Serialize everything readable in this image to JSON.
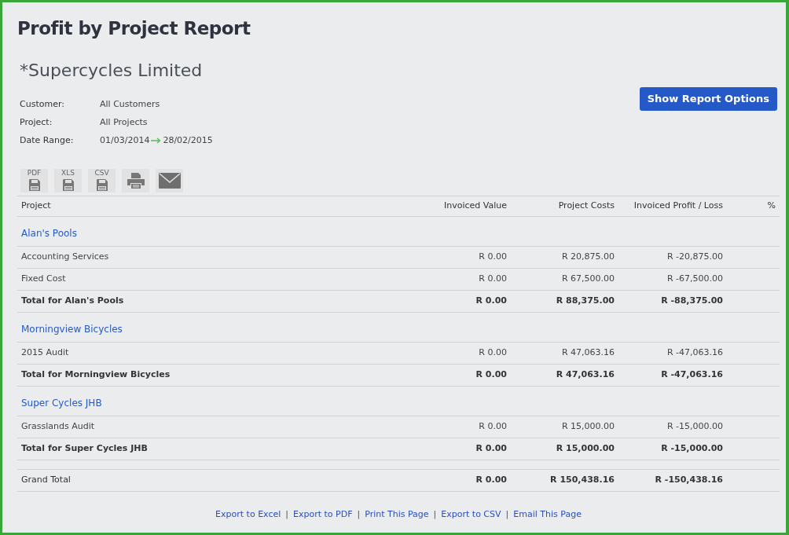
{
  "title": "Profit by Project Report",
  "company": "*Supercycles Limited",
  "filters": [
    {
      "label": "Customer:",
      "value": "All Customers"
    },
    {
      "label": "Project:",
      "value": "All Projects"
    },
    {
      "label": "Date Range:",
      "from": "01/03/2014",
      "to": "28/02/2015"
    }
  ],
  "options_button": "Show Report Options",
  "toolbar": [
    {
      "kind": "save",
      "label": "PDF"
    },
    {
      "kind": "save",
      "label": "XLS"
    },
    {
      "kind": "save",
      "label": "CSV"
    },
    {
      "kind": "print"
    },
    {
      "kind": "email"
    }
  ],
  "table": {
    "columns": [
      "Project",
      "Invoiced Value",
      "Project Costs",
      "Invoiced Profit / Loss",
      "%"
    ],
    "rows": [
      {
        "kind": "group",
        "name": "Alan's Pools"
      },
      {
        "kind": "item",
        "cells": [
          "Accounting Services",
          "R 0.00",
          "R 20,875.00",
          "R -20,875.00"
        ]
      },
      {
        "kind": "item",
        "cells": [
          "Fixed Cost",
          "R 0.00",
          "R 67,500.00",
          "R -67,500.00"
        ]
      },
      {
        "kind": "total",
        "cells": [
          "Total for Alan's Pools",
          "R 0.00",
          "R 88,375.00",
          "R -88,375.00"
        ]
      },
      {
        "kind": "group",
        "name": "Morningview Bicycles"
      },
      {
        "kind": "item",
        "cells": [
          "2015 Audit",
          "R 0.00",
          "R 47,063.16",
          "R -47,063.16"
        ]
      },
      {
        "kind": "total",
        "cells": [
          "Total for Morningview Bicycles",
          "R 0.00",
          "R 47,063.16",
          "R -47,063.16"
        ]
      },
      {
        "kind": "group",
        "name": "Super Cycles JHB"
      },
      {
        "kind": "item",
        "cells": [
          "Grasslands Audit",
          "R 0.00",
          "R 15,000.00",
          "R -15,000.00"
        ]
      },
      {
        "kind": "total",
        "cells": [
          "Total for Super Cycles JHB",
          "R 0.00",
          "R 15,000.00",
          "R -15,000.00"
        ]
      },
      {
        "kind": "spacer"
      },
      {
        "kind": "grand",
        "cells": [
          "Grand Total",
          "R 0.00",
          "R 150,438.16",
          "R -150,438.16"
        ]
      }
    ]
  },
  "footer": [
    {
      "kind": "link",
      "text": "Export to Excel"
    },
    {
      "kind": "separator",
      "text": "|"
    },
    {
      "kind": "link",
      "text": "Export to PDF"
    },
    {
      "kind": "separator",
      "text": "|"
    },
    {
      "kind": "link",
      "text": "Print This Page"
    },
    {
      "kind": "separator",
      "text": "|"
    },
    {
      "kind": "link",
      "text": "Export to CSV"
    },
    {
      "kind": "separator",
      "text": "|"
    },
    {
      "kind": "link",
      "text": "Email This Page"
    }
  ]
}
